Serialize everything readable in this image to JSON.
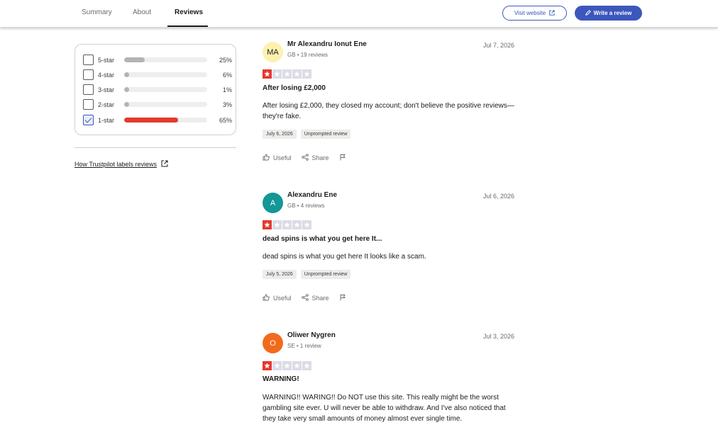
{
  "nav": {
    "tabs": [
      {
        "label": "Summary"
      },
      {
        "label": "About"
      },
      {
        "label": "Reviews",
        "active": true
      }
    ],
    "visit_label": "Visit website",
    "write_label": "Write a review",
    "accent": "#3c57bc"
  },
  "filters": {
    "items": [
      {
        "label": "5-star",
        "percent_text": "25%",
        "fraction": 0.25,
        "checked": false
      },
      {
        "label": "4-star",
        "percent_text": "6%",
        "fraction": 0.06,
        "checked": false
      },
      {
        "label": "3-star",
        "percent_text": "1%",
        "fraction": 0.01,
        "checked": false
      },
      {
        "label": "2-star",
        "percent_text": "3%",
        "fraction": 0.03,
        "checked": false
      },
      {
        "label": "1-star",
        "percent_text": "65%",
        "fraction": 0.65,
        "checked": true
      }
    ],
    "how_label": "How Trustpilot labels reviews"
  },
  "reviews": [
    {
      "initials": "MA",
      "avatar_bg": "#fdf1b0",
      "avatar_fg": "#1c1c1c",
      "name": "Mr Alexandru Ionut Ene",
      "meta": "GB • 19 reviews",
      "date": "Jul 7, 2026",
      "rating": 1,
      "title": "After losing £2,000",
      "body": "After losing £2,000, they closed my account; don't believe the positive reviews—they're fake.",
      "experience_date": "July 6, 2026",
      "label": "Unprompted review",
      "useful_label": "Useful",
      "share_label": "Share"
    },
    {
      "initials": "A",
      "avatar_bg": "#139797",
      "avatar_fg": "#ffffff",
      "name": "Alexandru Ene",
      "meta": "GB • 4 reviews",
      "date": "Jul 6, 2026",
      "rating": 1,
      "title": "dead spins is what you get here It...",
      "body": "dead spins is what you get here It looks like a scam.",
      "experience_date": "July 5, 2026",
      "label": "Unprompted review",
      "useful_label": "Useful",
      "share_label": "Share"
    },
    {
      "initials": "O",
      "avatar_bg": "#f26b1d",
      "avatar_fg": "#ffffff",
      "name": "Oliwer Nygren",
      "meta": "SE • 1 review",
      "date": "Jul 3, 2026",
      "rating": 1,
      "title": "WARNING!",
      "body": "WARNING!! WARING!! Do NOT use this site. This really might be the worst gambling site ever. U will never be able to withdraw. And I've also noticed that they take very small amounts of money almost ever single time."
    }
  ],
  "colors": {
    "star_on": "#e5392e",
    "star_off": "#dcdce6"
  }
}
